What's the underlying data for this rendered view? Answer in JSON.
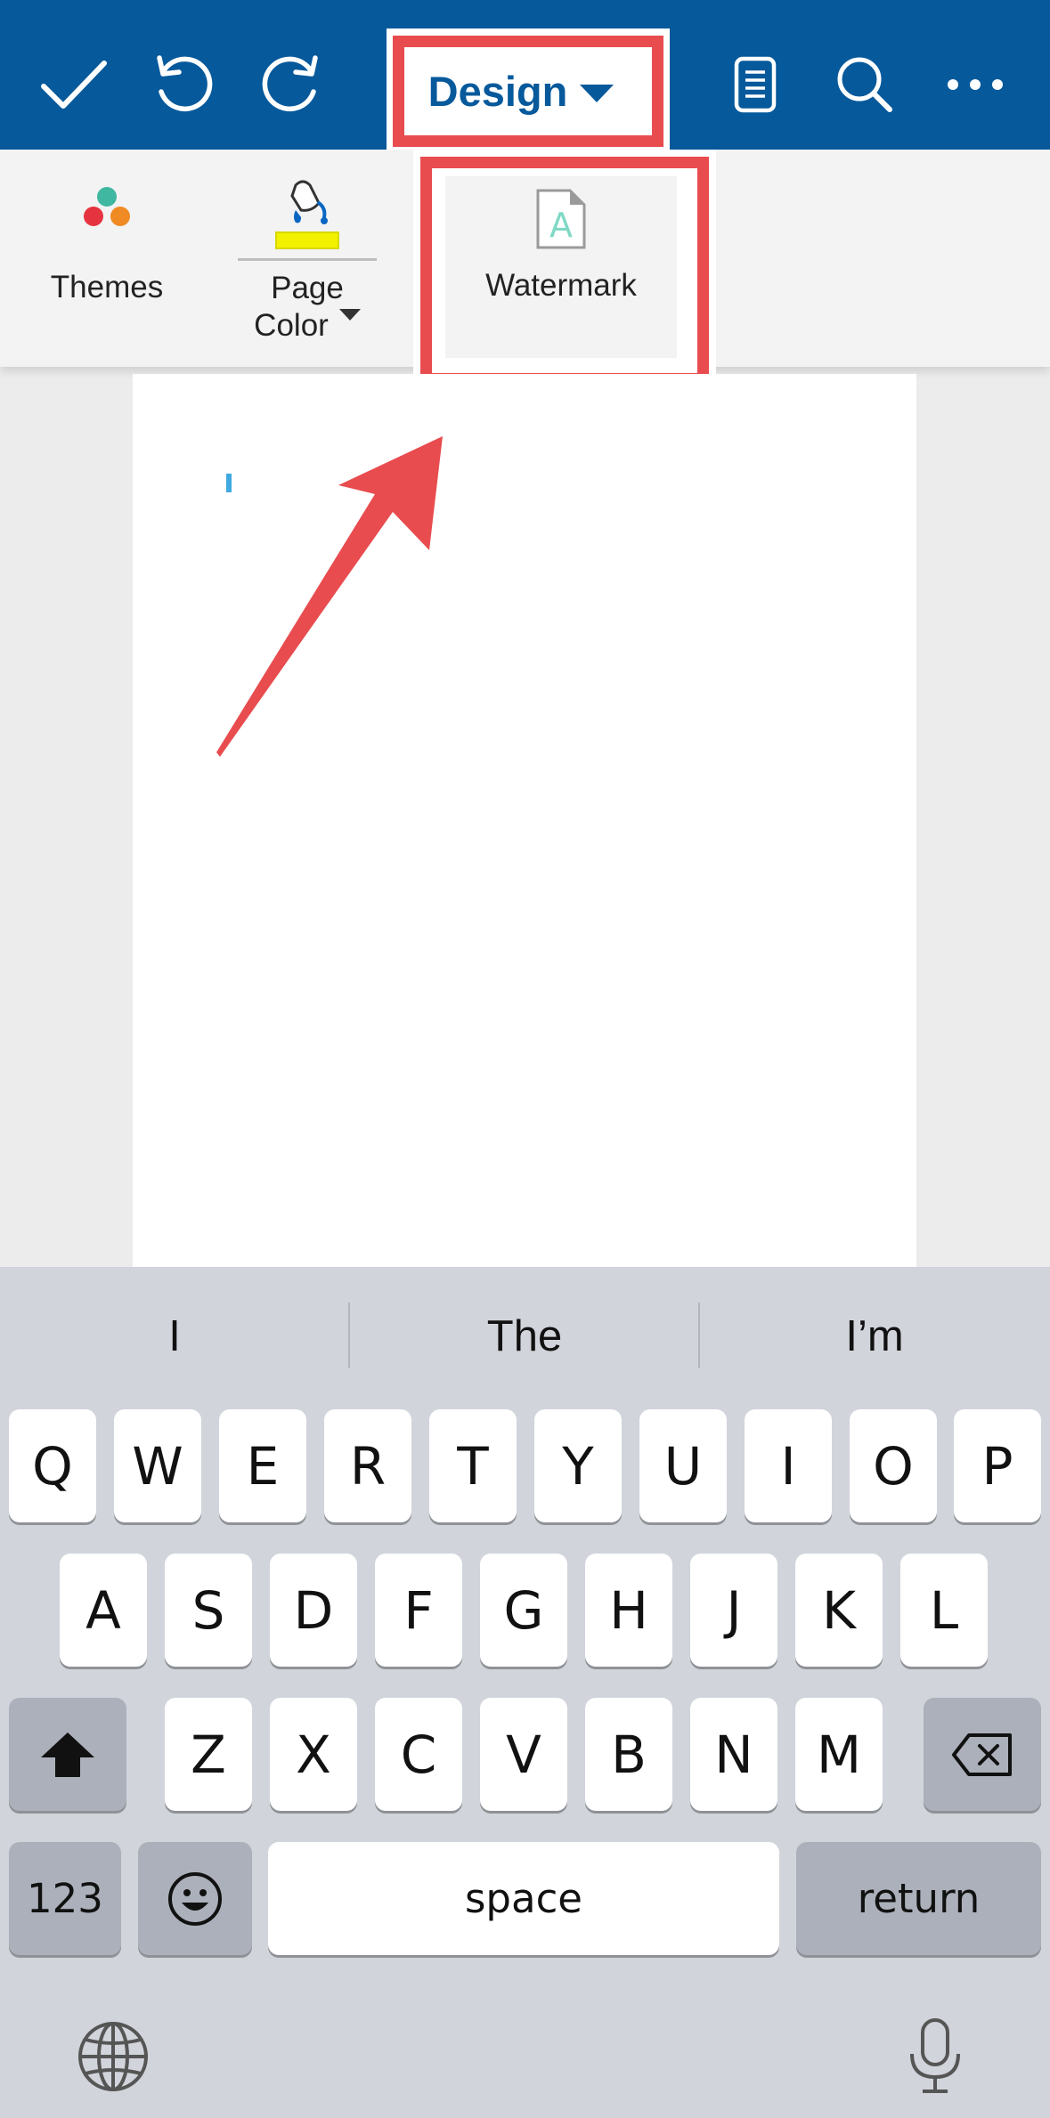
{
  "toolbar": {
    "done_icon": "checkmark-icon",
    "undo_icon": "undo-icon",
    "redo_icon": "redo-icon",
    "tab_label": "Design",
    "mobile_view_icon": "mobile-view-icon",
    "search_icon": "search-icon",
    "more_icon": "more-icon"
  },
  "ribbon": {
    "themes_label": "Themes",
    "page_color_label_line1": "Page",
    "page_color_label_line2": "Color",
    "watermark_label": "Watermark",
    "page_color_swatch": "#f2f200"
  },
  "keyboard": {
    "suggestions": [
      "I",
      "The",
      "I’m"
    ],
    "row1": [
      "Q",
      "W",
      "E",
      "R",
      "T",
      "Y",
      "U",
      "I",
      "O",
      "P"
    ],
    "row2": [
      "A",
      "S",
      "D",
      "F",
      "G",
      "H",
      "J",
      "K",
      "L"
    ],
    "row3": [
      "Z",
      "X",
      "C",
      "V",
      "B",
      "N",
      "M"
    ],
    "numbers_label": "123",
    "space_label": "space",
    "return_label": "return"
  },
  "colors": {
    "toolbar_bg": "#06599b",
    "highlight": "#e84c4f",
    "cursor": "#3fa9e0"
  }
}
